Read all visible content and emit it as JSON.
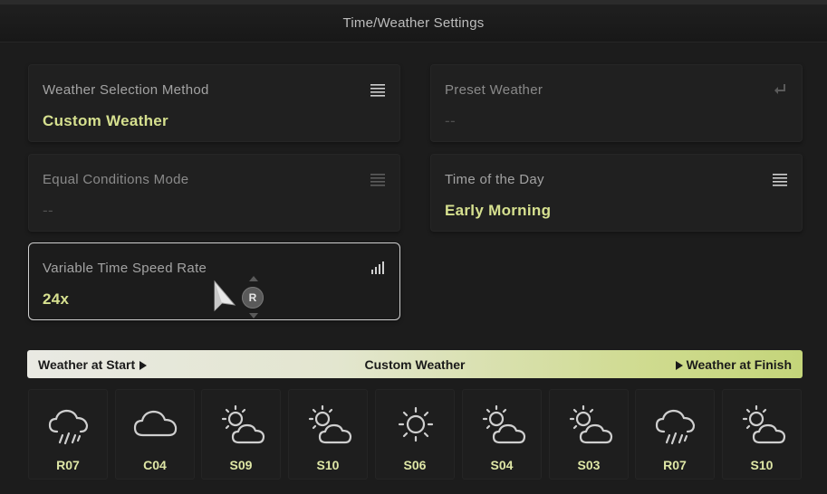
{
  "window": {
    "title": "Time/Weather Settings"
  },
  "settings": {
    "weather_selection": {
      "label": "Weather Selection Method",
      "value": "Custom Weather",
      "icon": "list-icon"
    },
    "preset_weather": {
      "label": "Preset Weather",
      "value": "--",
      "icon": "return-icon"
    },
    "equal_conditions": {
      "label": "Equal Conditions Mode",
      "value": "--",
      "icon": "list-icon"
    },
    "time_of_day": {
      "label": "Time of the Day",
      "value": "Early Morning",
      "icon": "list-icon"
    },
    "time_speed": {
      "label": "Variable Time Speed Rate",
      "value": "24x",
      "icon": "signal-bars-icon"
    }
  },
  "controller_hint": {
    "button": "R"
  },
  "weather_bar": {
    "start_label": "Weather at Start",
    "center_label": "Custom Weather",
    "finish_label": "Weather at Finish"
  },
  "weather_slots": [
    {
      "code": "R07",
      "icon": "rain-icon"
    },
    {
      "code": "C04",
      "icon": "cloud-icon"
    },
    {
      "code": "S09",
      "icon": "sun-cloud-icon"
    },
    {
      "code": "S10",
      "icon": "sun-cloud-icon"
    },
    {
      "code": "S06",
      "icon": "sun-icon"
    },
    {
      "code": "S04",
      "icon": "sun-cloud-icon"
    },
    {
      "code": "S03",
      "icon": "sun-cloud-icon"
    },
    {
      "code": "R07",
      "icon": "rain-icon"
    },
    {
      "code": "S10",
      "icon": "sun-cloud-icon"
    }
  ],
  "colors": {
    "accent": "#d6e08f",
    "background": "#1c1c1c",
    "card": "#202020"
  }
}
